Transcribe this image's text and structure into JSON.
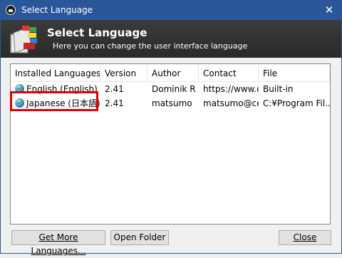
{
  "window": {
    "title": "Select Language",
    "close_glyph": "✕"
  },
  "header": {
    "title": "Select Language",
    "subtitle": "Here you can change the user interface language",
    "icon": "language-book-icon"
  },
  "table": {
    "columns": [
      "Installed Languages",
      "Version",
      "Author",
      "Contact",
      "File"
    ],
    "rows": [
      {
        "language": "English (English)",
        "version": "2.41",
        "author": "Dominik R",
        "contact": "https://www.c",
        "file": "Built-in",
        "icon": "globe-icon"
      },
      {
        "language": "Japanese (日本語)",
        "version": "2.41",
        "author": "matsumo",
        "contact": "matsumo@ce",
        "file": "C:¥Program Fil...",
        "icon": "globe-icon"
      }
    ],
    "highlight_color": "#e10000"
  },
  "buttons": {
    "get_more": "Get More Languages...",
    "open_folder": "Open Folder",
    "close": "Close"
  },
  "colors": {
    "titlebar": "#2b579a",
    "header_bg": "#333333"
  }
}
